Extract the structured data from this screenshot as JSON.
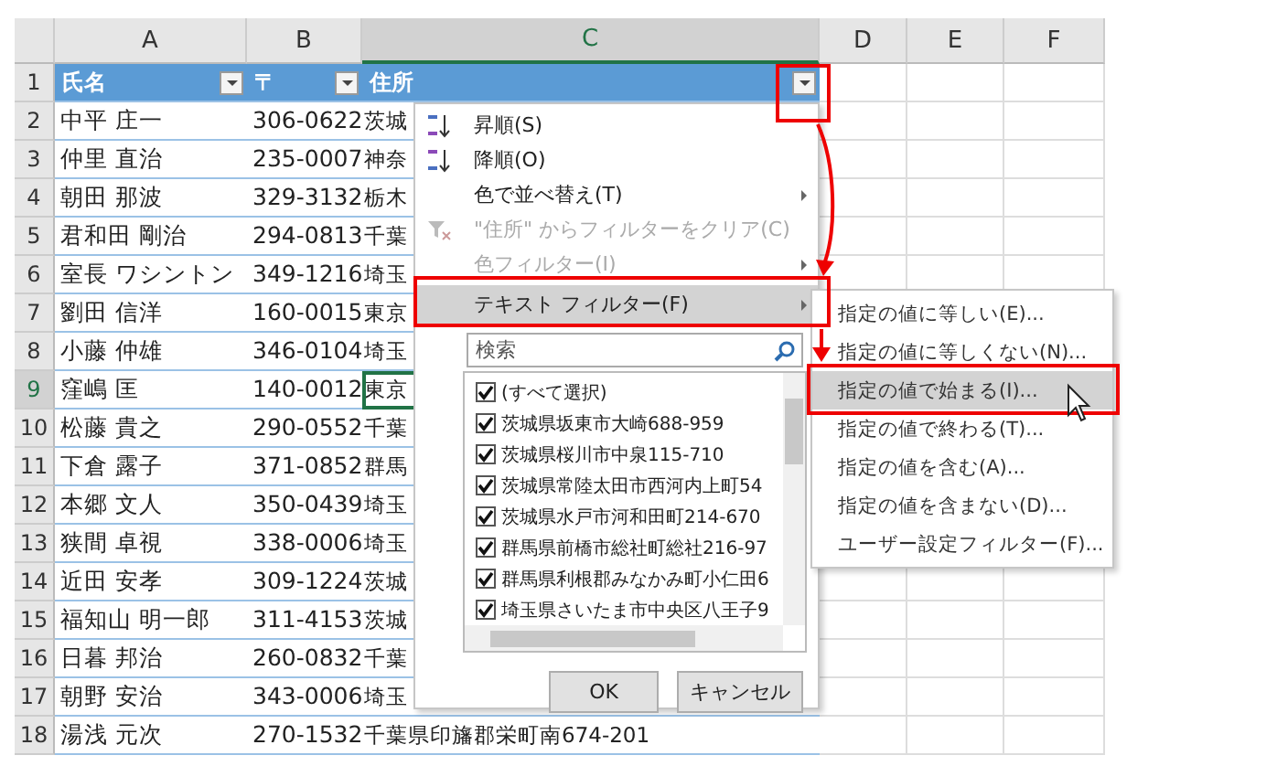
{
  "columns": [
    {
      "label": "A",
      "selected": false
    },
    {
      "label": "B",
      "selected": false
    },
    {
      "label": "C",
      "selected": true
    },
    {
      "label": "D",
      "selected": false
    },
    {
      "label": "E",
      "selected": false
    },
    {
      "label": "F",
      "selected": false
    }
  ],
  "header_row": {
    "number": "1",
    "cells": [
      "氏名",
      "〒",
      "住所"
    ]
  },
  "rows": [
    {
      "number": "2",
      "selected": false,
      "cells": [
        "中平 庄一",
        "306-0622",
        "茨城"
      ]
    },
    {
      "number": "3",
      "selected": false,
      "cells": [
        "仲里 直治",
        "235-0007",
        "神奈"
      ]
    },
    {
      "number": "4",
      "selected": false,
      "cells": [
        "朝田 那波",
        "329-3132",
        "栃木"
      ]
    },
    {
      "number": "5",
      "selected": false,
      "cells": [
        "君和田 剛治",
        "294-0813",
        "千葉"
      ]
    },
    {
      "number": "6",
      "selected": false,
      "cells": [
        "室長 ワシントン",
        "349-1216",
        "埼玉"
      ]
    },
    {
      "number": "7",
      "selected": false,
      "cells": [
        "劉田 信洋",
        "160-0015",
        "東京"
      ]
    },
    {
      "number": "8",
      "selected": false,
      "cells": [
        "小藤 仲雄",
        "346-0104",
        "埼玉"
      ]
    },
    {
      "number": "9",
      "selected": true,
      "cells": [
        "窪嶋 匡",
        "140-0012",
        "東京"
      ]
    },
    {
      "number": "10",
      "selected": false,
      "cells": [
        "松藤 貴之",
        "290-0552",
        "千葉"
      ]
    },
    {
      "number": "11",
      "selected": false,
      "cells": [
        "下倉 露子",
        "371-0852",
        "群馬"
      ]
    },
    {
      "number": "12",
      "selected": false,
      "cells": [
        "本郷 文人",
        "350-0439",
        "埼玉"
      ]
    },
    {
      "number": "13",
      "selected": false,
      "cells": [
        "狭間 卓視",
        "338-0006",
        "埼玉"
      ]
    },
    {
      "number": "14",
      "selected": false,
      "cells": [
        "近田 安孝",
        "309-1224",
        "茨城"
      ]
    },
    {
      "number": "15",
      "selected": false,
      "cells": [
        "福知山 明一郎",
        "311-4153",
        "茨城"
      ]
    },
    {
      "number": "16",
      "selected": false,
      "cells": [
        "日暮 邦治",
        "260-0832",
        "千葉"
      ]
    },
    {
      "number": "17",
      "selected": false,
      "cells": [
        "朝野 安治",
        "343-0006",
        "埼玉"
      ]
    },
    {
      "number": "18",
      "selected": false,
      "cells": [
        "湯浅 元次",
        "270-1532",
        "千葉県印旛郡栄町南674-201"
      ]
    }
  ],
  "filter_menu": {
    "items": [
      {
        "kind": "sort-asc",
        "label": "昇順(S)",
        "submenu": false,
        "disabled": false,
        "selected": false
      },
      {
        "kind": "sort-desc",
        "label": "降順(O)",
        "submenu": false,
        "disabled": false,
        "selected": false
      },
      {
        "kind": "plain",
        "label": "色で並べ替え(T)",
        "submenu": true,
        "disabled": false,
        "selected": false
      },
      {
        "kind": "clear",
        "label": "\"住所\" からフィルターをクリア(C)",
        "submenu": false,
        "disabled": true,
        "selected": false
      },
      {
        "kind": "plain",
        "label": "色フィルター(I)",
        "submenu": true,
        "disabled": true,
        "selected": false
      },
      {
        "kind": "plain",
        "label": "テキスト フィルター(F)",
        "submenu": true,
        "disabled": false,
        "selected": true
      }
    ],
    "search": {
      "placeholder": "検索"
    },
    "values": [
      {
        "label": "(すべて選択)",
        "checked": true
      },
      {
        "label": "茨城県坂東市大崎688-959",
        "checked": true
      },
      {
        "label": "茨城県桜川市中泉115-710",
        "checked": true
      },
      {
        "label": "茨城県常陸太田市西河内上町54",
        "checked": true
      },
      {
        "label": "茨城県水戸市河和田町214-670",
        "checked": true
      },
      {
        "label": "群馬県前橋市総社町総社216-97",
        "checked": true
      },
      {
        "label": "群馬県利根郡みなかみ町小仁田6",
        "checked": true
      },
      {
        "label": "埼玉県さいたま市中央区八王子9",
        "checked": true
      }
    ],
    "buttons": [
      "OK",
      "キャンセル"
    ]
  },
  "text_filter_menu": {
    "items": [
      {
        "label": "指定の値に等しい(E)...",
        "selected": false
      },
      {
        "label": "指定の値に等しくない(N)...",
        "selected": false
      },
      {
        "label": "指定の値で始まる(I)...",
        "selected": true
      },
      {
        "label": "指定の値で終わる(T)...",
        "selected": false
      },
      {
        "label": "指定の値を含む(A)...",
        "selected": false
      },
      {
        "label": "指定の値を含まない(D)...",
        "selected": false
      },
      {
        "label": "ユーザー設定フィルター(F)...",
        "selected": false
      }
    ]
  }
}
